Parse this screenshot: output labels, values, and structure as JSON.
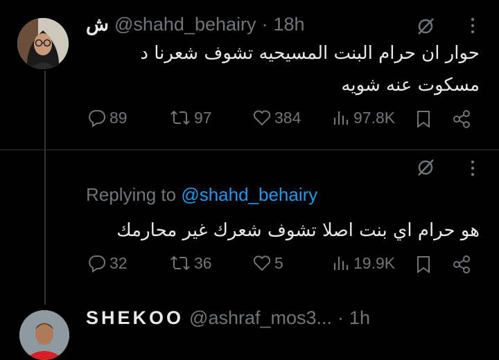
{
  "tweets": [
    {
      "display_name": "ش",
      "handle": "@shahd_behairy",
      "separator": "·",
      "time": "18h",
      "text": "حوار ان حرام البنت المسيحيه تشوف شعرنا د مسكوت عنه شويه",
      "stats": {
        "replies": "89",
        "reposts": "97",
        "likes": "384",
        "views": "97.8K"
      }
    },
    {
      "display_name": "SHEKOO",
      "handle": "@ashraf_mos3...",
      "separator": "·",
      "time": "1h",
      "replying_label": "Replying to",
      "replying_to": "@shahd_behairy",
      "text": "هو حرام اي بنت اصلا تشوف شعرك غير محارمك",
      "stats": {
        "replies": "32",
        "reposts": "36",
        "likes": "5",
        "views": "19.9K"
      }
    }
  ],
  "icons": [
    "grok-icon",
    "more-icon",
    "reply-icon",
    "repost-icon",
    "like-icon",
    "views-icon",
    "bookmark-icon",
    "share-icon"
  ],
  "colors": {
    "background": "#000000",
    "text": "#e7e9ea",
    "muted": "#71767b",
    "link": "#1d9bf0"
  }
}
